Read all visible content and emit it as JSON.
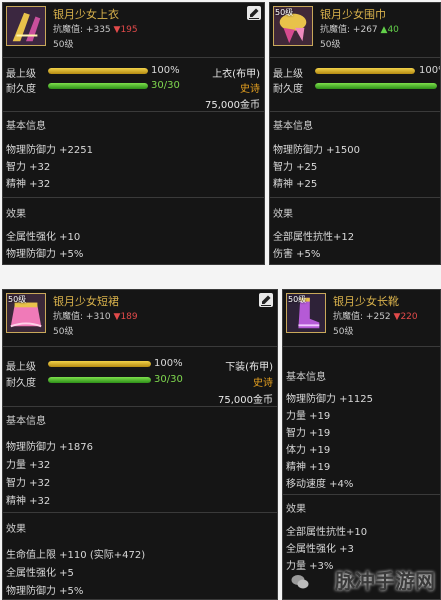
{
  "items": [
    {
      "name": "银月少女上衣",
      "mag_label": "抗魔值:",
      "mag_value": "+335",
      "mag_delta": "▼195",
      "mag_dir": "down",
      "level": "50级",
      "level_tag": "",
      "max_label": "最上级",
      "max_pct": "100%",
      "max_fill": 1.0,
      "dur_label": "耐久度",
      "dur_val": "30/30",
      "dur_fill": 1.0,
      "slot": "上衣(布甲)",
      "rarity": "史诗",
      "price": "75,000金币",
      "basic_title": "基本信息",
      "basic": [
        "物理防御力 +2251",
        "智力 +32",
        "精神 +32"
      ],
      "effect_title": "效果",
      "effects": [
        "全属性强化 +10",
        "物理防御力 +5%"
      ]
    },
    {
      "name": "银月少女围巾",
      "mag_label": "抗魔值:",
      "mag_value": "+267",
      "mag_delta": "▲40",
      "mag_dir": "up",
      "level": "50级",
      "level_tag": "50级",
      "max_label": "最上级",
      "max_pct": "100%",
      "max_fill": 1.0,
      "dur_label": "耐久度",
      "dur_val": "",
      "dur_fill": 1.0,
      "slot": "",
      "rarity": "",
      "price": "",
      "basic_title": "基本信息",
      "basic": [
        "物理防御力 +1500",
        "智力 +25",
        "精神 +25"
      ],
      "effect_title": "效果",
      "effects": [
        "全部属性抗性+12",
        "伤害 +5%"
      ]
    },
    {
      "name": "银月少女短裙",
      "mag_label": "抗魔值:",
      "mag_value": "+310",
      "mag_delta": "▼189",
      "mag_dir": "down",
      "level": "50级",
      "level_tag": "50级",
      "max_label": "最上级",
      "max_pct": "100%",
      "max_fill": 1.0,
      "dur_label": "耐久度",
      "dur_val": "30/30",
      "dur_fill": 1.0,
      "slot": "下装(布甲)",
      "rarity": "史诗",
      "price": "75,000金币",
      "basic_title": "基本信息",
      "basic": [
        "物理防御力 +1876",
        "力量 +32",
        "智力 +32",
        "精神 +32"
      ],
      "effect_title": "效果",
      "effects": [
        "生命值上限 +110 (实际+472)",
        "全属性强化 +5",
        "物理防御力 +5%"
      ]
    },
    {
      "name": "银月少女长靴",
      "mag_label": "抗魔值:",
      "mag_value": "+252",
      "mag_delta": "▼220",
      "mag_dir": "down",
      "level": "50级",
      "level_tag": "50级",
      "basic_title": "基本信息",
      "basic": [
        "物理防御力 +1125",
        "力量 +19",
        "智力 +19",
        "体力 +19",
        "精神 +19",
        "移动速度 +4%"
      ],
      "effect_title": "效果",
      "effects": [
        "全部属性抗性+10",
        "全属性强化 +3",
        "力量 +3%"
      ]
    }
  ],
  "watermark": "脉冲手游网"
}
